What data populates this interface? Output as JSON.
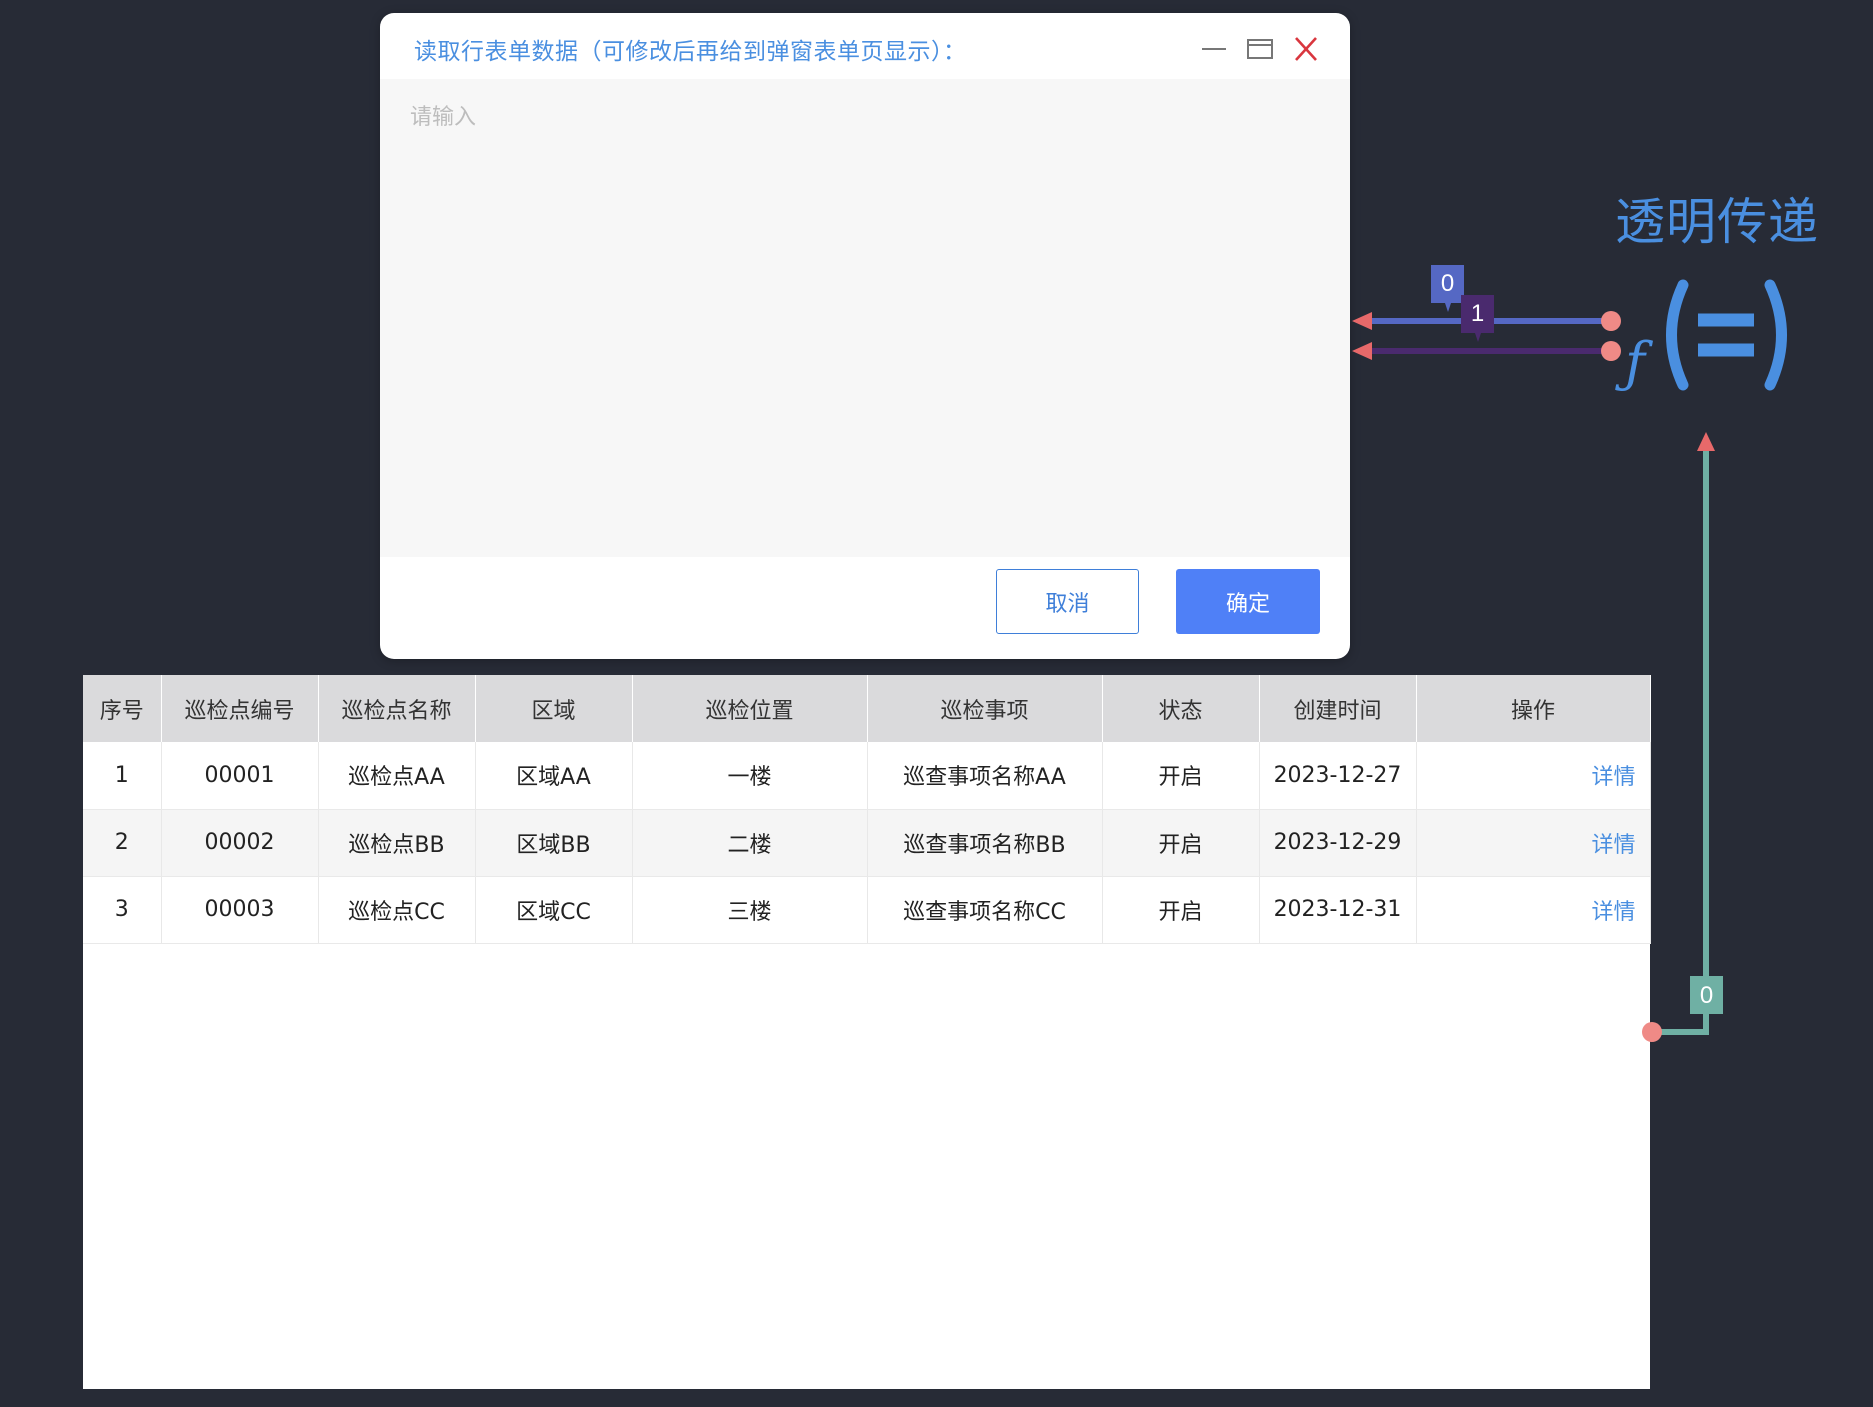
{
  "dialog": {
    "title": "读取行表单数据（可修改后再给到弹窗表单页显示）：",
    "placeholder": "请输入",
    "cancel_label": "取消",
    "ok_label": "确定"
  },
  "table": {
    "columns": [
      "序号",
      "巡检点编号",
      "巡检点名称",
      "区域",
      "巡检位置",
      "巡检事项",
      "状态",
      "创建时间",
      "操作"
    ],
    "rows": [
      {
        "index": "1",
        "code": "00001",
        "name": "巡检点AA",
        "area": "区域AA",
        "position": "一楼",
        "item": "巡查事项名称AA",
        "status": "开启",
        "created": "2023-12-27",
        "action": "详情"
      },
      {
        "index": "2",
        "code": "00002",
        "name": "巡检点BB",
        "area": "区域BB",
        "position": "二楼",
        "item": "巡查事项名称BB",
        "status": "开启",
        "created": "2023-12-29",
        "action": "详情"
      },
      {
        "index": "3",
        "code": "00003",
        "name": "巡检点CC",
        "area": "区域CC",
        "position": "三楼",
        "item": "巡查事项名称CC",
        "status": "开启",
        "created": "2023-12-31",
        "action": "详情"
      }
    ]
  },
  "flow": {
    "node_title": "透明传递",
    "node_icon": "function-equals-icon",
    "link_labels": [
      "0",
      "1",
      "0"
    ],
    "colors": {
      "background": "#272b36",
      "accent": "#4a8fe0",
      "link_0": "#5568c4",
      "link_1": "#4a2a6e",
      "link_table": "#6fb0a4",
      "port": "#ef8a86"
    }
  }
}
